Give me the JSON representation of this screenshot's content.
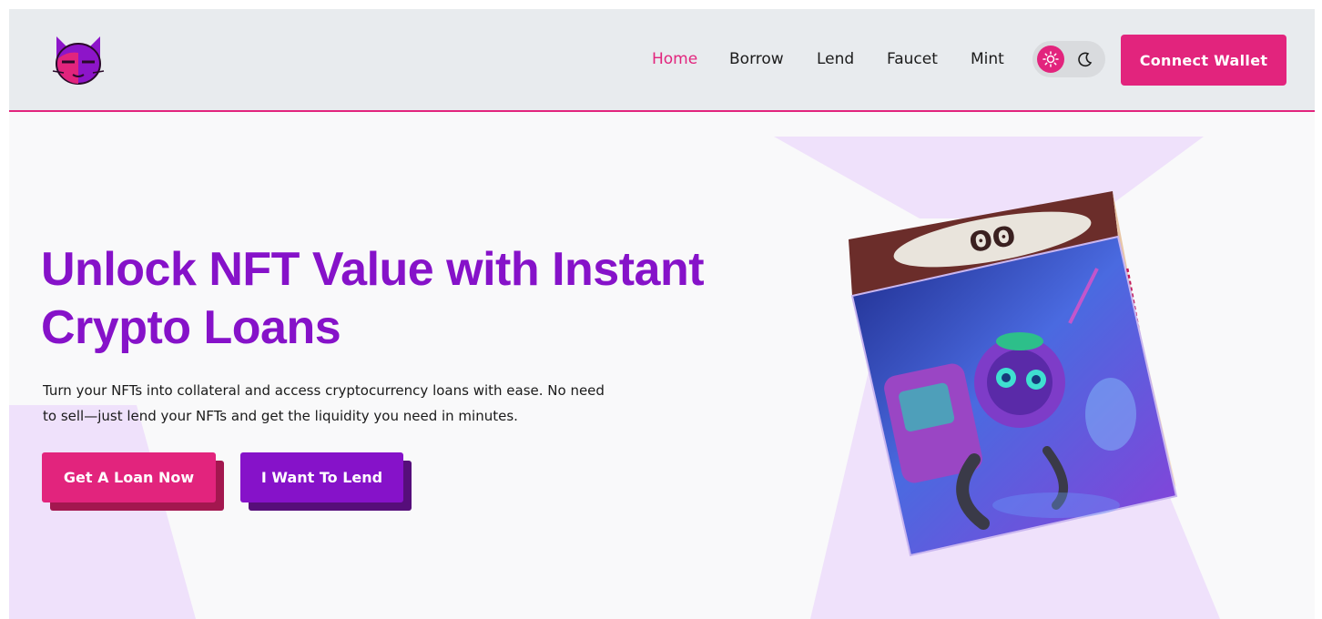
{
  "header": {
    "logo_icon": "cat-face-logo",
    "nav": [
      {
        "label": "Home",
        "active": true
      },
      {
        "label": "Borrow",
        "active": false
      },
      {
        "label": "Lend",
        "active": false
      },
      {
        "label": "Faucet",
        "active": false
      },
      {
        "label": "Mint",
        "active": false
      }
    ],
    "theme_toggle": {
      "selected": "light",
      "icons": [
        "sun-icon",
        "moon-icon"
      ]
    },
    "connect_wallet_label": "Connect Wallet"
  },
  "hero": {
    "title": "Unlock NFT Value with Instant Crypto Loans",
    "description": "Turn your NFTs into collateral and access cryptocurrency loans with ease. No need to sell—just lend your NFTs and get the liquidity you need in minutes.",
    "primary_button_label": "Get A Loan Now",
    "secondary_button_label": "I Want To Lend",
    "image": "rotating-nft-cube-robot"
  },
  "colors": {
    "accent_pink": "#e2247d",
    "accent_purple": "#8612c9",
    "header_bg": "#e8ebee",
    "page_bg": "#f9f9fa",
    "lavender": "#efe1fb"
  }
}
